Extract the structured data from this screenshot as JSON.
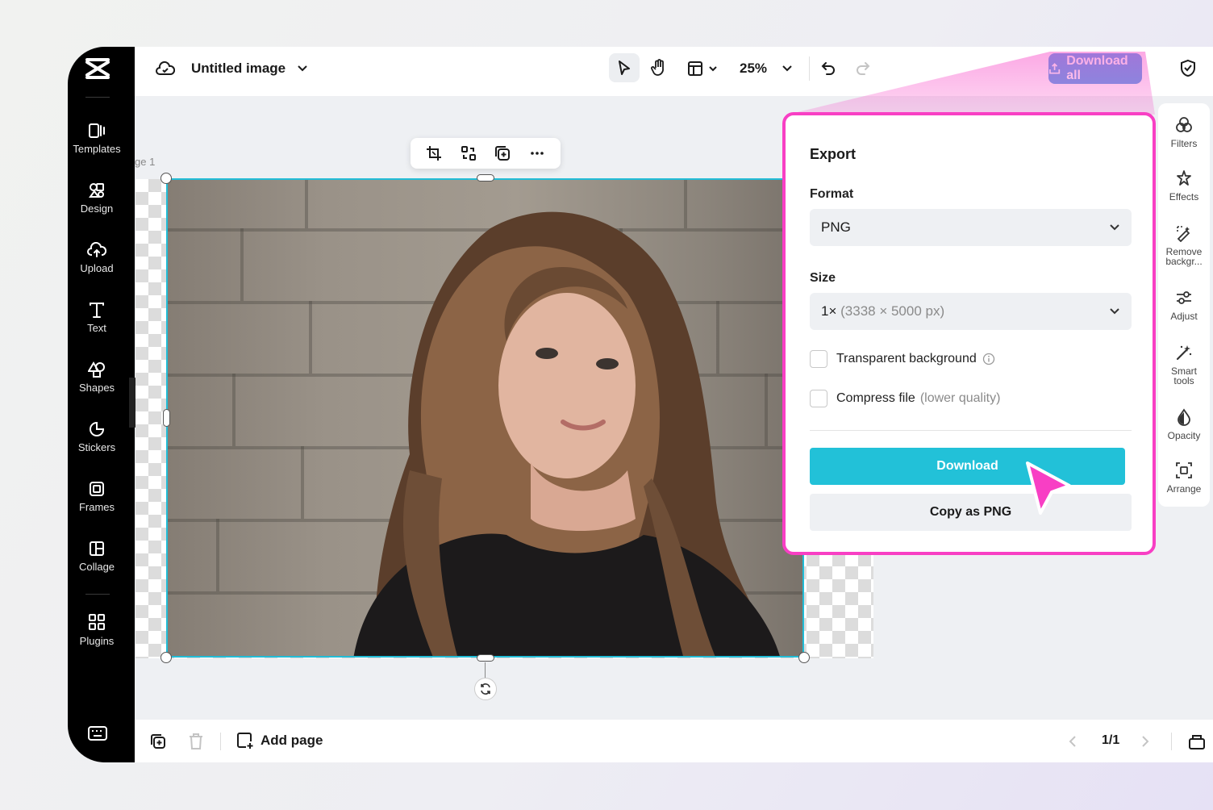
{
  "app": {
    "title": "Untitled image",
    "zoom": "25%",
    "download_all_label": "Download all",
    "page_label": "ge 1"
  },
  "sidebar": {
    "items": [
      {
        "label": "Templates",
        "icon": "templates-icon"
      },
      {
        "label": "Design",
        "icon": "design-icon"
      },
      {
        "label": "Upload",
        "icon": "upload-cloud-icon"
      },
      {
        "label": "Text",
        "icon": "text-icon"
      },
      {
        "label": "Shapes",
        "icon": "shapes-icon"
      },
      {
        "label": "Stickers",
        "icon": "stickers-icon"
      },
      {
        "label": "Frames",
        "icon": "frames-icon"
      },
      {
        "label": "Collage",
        "icon": "collage-icon"
      },
      {
        "label": "Plugins",
        "icon": "plugins-icon"
      }
    ]
  },
  "rightbar": {
    "items": [
      {
        "label": "Filters",
        "icon": "filters-icon"
      },
      {
        "label": "Effects",
        "icon": "effects-icon"
      },
      {
        "label": "Remove backgr...",
        "label_line1": "Remove",
        "label_line2": "backgr...",
        "icon": "remove-background-icon"
      },
      {
        "label": "Adjust",
        "icon": "adjust-icon"
      },
      {
        "label": "Smart tools",
        "label_line1": "Smart",
        "label_line2": "tools",
        "icon": "smart-tools-icon"
      },
      {
        "label": "Opacity",
        "icon": "opacity-icon"
      },
      {
        "label": "Arrange",
        "icon": "arrange-icon"
      }
    ]
  },
  "export": {
    "title": "Export",
    "format_label": "Format",
    "format_value": "PNG",
    "size_label": "Size",
    "size_value": "1×",
    "size_detail": "(3338 × 5000 px)",
    "transparent_label": "Transparent background",
    "transparent_checked": false,
    "compress_label": "Compress file",
    "compress_note": "(lower quality)",
    "compress_checked": false,
    "download_label": "Download",
    "copy_label": "Copy as PNG"
  },
  "bottombar": {
    "add_page_label": "Add page",
    "pager": "1/1"
  },
  "colors": {
    "accent": "#22c1d8",
    "highlight": "#f83fc4",
    "download_all": "#5aa4ea"
  }
}
